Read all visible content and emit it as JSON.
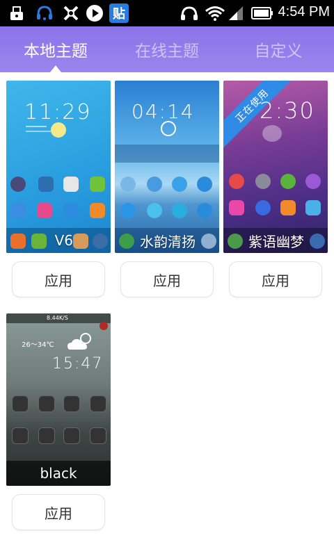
{
  "status_bar": {
    "time": "4:54 PM",
    "left_icons": [
      "toolbox-icon",
      "headset-bell-icon",
      "flower-logo-icon",
      "play-icon",
      "tieba-icon"
    ],
    "tieba_char": "贴",
    "right_icons": [
      "headphones-icon",
      "wifi-icon",
      "signal-icon",
      "battery-icon"
    ]
  },
  "tabs": [
    {
      "label": "本地主题",
      "active": true
    },
    {
      "label": "在线主题",
      "active": false
    },
    {
      "label": "自定义",
      "active": false
    }
  ],
  "themes": [
    {
      "name": "V6",
      "time": "11:29",
      "apply_label": "应用"
    },
    {
      "name": "水韵清扬",
      "time": "04:14",
      "apply_label": "应用"
    },
    {
      "name": "紫语幽梦",
      "time": "2:30",
      "badge": "正在使用",
      "apply_label": "应用"
    },
    {
      "name": "black",
      "time": "15:47",
      "temp": "26～34℃",
      "speed": "8.44K/S",
      "apply_label": "应用"
    }
  ],
  "colors": {
    "tab_bar": "#8a73e8",
    "badge_blue": "#2f8be6"
  }
}
